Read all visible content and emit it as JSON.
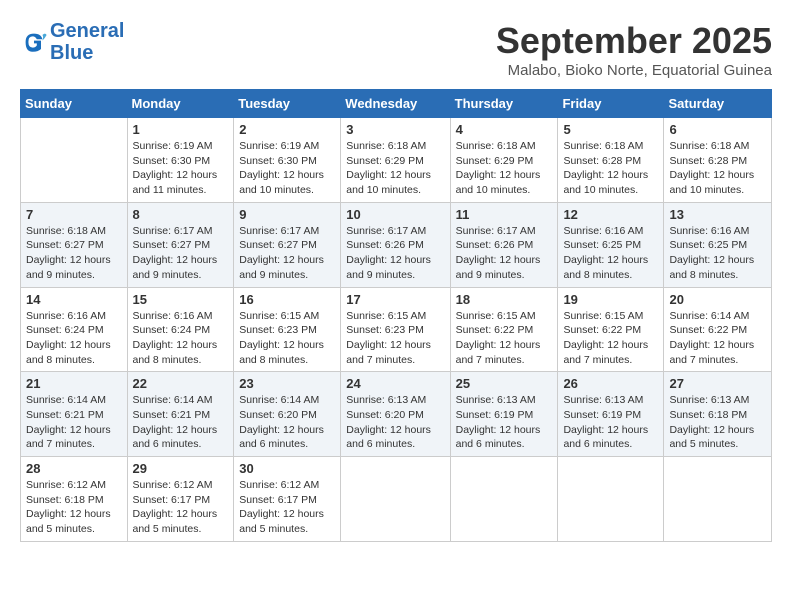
{
  "logo": {
    "line1": "General",
    "line2": "Blue"
  },
  "header": {
    "month": "September 2025",
    "location": "Malabo, Bioko Norte, Equatorial Guinea"
  },
  "days_of_week": [
    "Sunday",
    "Monday",
    "Tuesday",
    "Wednesday",
    "Thursday",
    "Friday",
    "Saturday"
  ],
  "weeks": [
    [
      {
        "day": "",
        "info": ""
      },
      {
        "day": "1",
        "info": "Sunrise: 6:19 AM\nSunset: 6:30 PM\nDaylight: 12 hours and 11 minutes."
      },
      {
        "day": "2",
        "info": "Sunrise: 6:19 AM\nSunset: 6:30 PM\nDaylight: 12 hours and 10 minutes."
      },
      {
        "day": "3",
        "info": "Sunrise: 6:18 AM\nSunset: 6:29 PM\nDaylight: 12 hours and 10 minutes."
      },
      {
        "day": "4",
        "info": "Sunrise: 6:18 AM\nSunset: 6:29 PM\nDaylight: 12 hours and 10 minutes."
      },
      {
        "day": "5",
        "info": "Sunrise: 6:18 AM\nSunset: 6:28 PM\nDaylight: 12 hours and 10 minutes."
      },
      {
        "day": "6",
        "info": "Sunrise: 6:18 AM\nSunset: 6:28 PM\nDaylight: 12 hours and 10 minutes."
      }
    ],
    [
      {
        "day": "7",
        "info": "Sunrise: 6:18 AM\nSunset: 6:27 PM\nDaylight: 12 hours and 9 minutes."
      },
      {
        "day": "8",
        "info": "Sunrise: 6:17 AM\nSunset: 6:27 PM\nDaylight: 12 hours and 9 minutes."
      },
      {
        "day": "9",
        "info": "Sunrise: 6:17 AM\nSunset: 6:27 PM\nDaylight: 12 hours and 9 minutes."
      },
      {
        "day": "10",
        "info": "Sunrise: 6:17 AM\nSunset: 6:26 PM\nDaylight: 12 hours and 9 minutes."
      },
      {
        "day": "11",
        "info": "Sunrise: 6:17 AM\nSunset: 6:26 PM\nDaylight: 12 hours and 9 minutes."
      },
      {
        "day": "12",
        "info": "Sunrise: 6:16 AM\nSunset: 6:25 PM\nDaylight: 12 hours and 8 minutes."
      },
      {
        "day": "13",
        "info": "Sunrise: 6:16 AM\nSunset: 6:25 PM\nDaylight: 12 hours and 8 minutes."
      }
    ],
    [
      {
        "day": "14",
        "info": "Sunrise: 6:16 AM\nSunset: 6:24 PM\nDaylight: 12 hours and 8 minutes."
      },
      {
        "day": "15",
        "info": "Sunrise: 6:16 AM\nSunset: 6:24 PM\nDaylight: 12 hours and 8 minutes."
      },
      {
        "day": "16",
        "info": "Sunrise: 6:15 AM\nSunset: 6:23 PM\nDaylight: 12 hours and 8 minutes."
      },
      {
        "day": "17",
        "info": "Sunrise: 6:15 AM\nSunset: 6:23 PM\nDaylight: 12 hours and 7 minutes."
      },
      {
        "day": "18",
        "info": "Sunrise: 6:15 AM\nSunset: 6:22 PM\nDaylight: 12 hours and 7 minutes."
      },
      {
        "day": "19",
        "info": "Sunrise: 6:15 AM\nSunset: 6:22 PM\nDaylight: 12 hours and 7 minutes."
      },
      {
        "day": "20",
        "info": "Sunrise: 6:14 AM\nSunset: 6:22 PM\nDaylight: 12 hours and 7 minutes."
      }
    ],
    [
      {
        "day": "21",
        "info": "Sunrise: 6:14 AM\nSunset: 6:21 PM\nDaylight: 12 hours and 7 minutes."
      },
      {
        "day": "22",
        "info": "Sunrise: 6:14 AM\nSunset: 6:21 PM\nDaylight: 12 hours and 6 minutes."
      },
      {
        "day": "23",
        "info": "Sunrise: 6:14 AM\nSunset: 6:20 PM\nDaylight: 12 hours and 6 minutes."
      },
      {
        "day": "24",
        "info": "Sunrise: 6:13 AM\nSunset: 6:20 PM\nDaylight: 12 hours and 6 minutes."
      },
      {
        "day": "25",
        "info": "Sunrise: 6:13 AM\nSunset: 6:19 PM\nDaylight: 12 hours and 6 minutes."
      },
      {
        "day": "26",
        "info": "Sunrise: 6:13 AM\nSunset: 6:19 PM\nDaylight: 12 hours and 6 minutes."
      },
      {
        "day": "27",
        "info": "Sunrise: 6:13 AM\nSunset: 6:18 PM\nDaylight: 12 hours and 5 minutes."
      }
    ],
    [
      {
        "day": "28",
        "info": "Sunrise: 6:12 AM\nSunset: 6:18 PM\nDaylight: 12 hours and 5 minutes."
      },
      {
        "day": "29",
        "info": "Sunrise: 6:12 AM\nSunset: 6:17 PM\nDaylight: 12 hours and 5 minutes."
      },
      {
        "day": "30",
        "info": "Sunrise: 6:12 AM\nSunset: 6:17 PM\nDaylight: 12 hours and 5 minutes."
      },
      {
        "day": "",
        "info": ""
      },
      {
        "day": "",
        "info": ""
      },
      {
        "day": "",
        "info": ""
      },
      {
        "day": "",
        "info": ""
      }
    ]
  ]
}
